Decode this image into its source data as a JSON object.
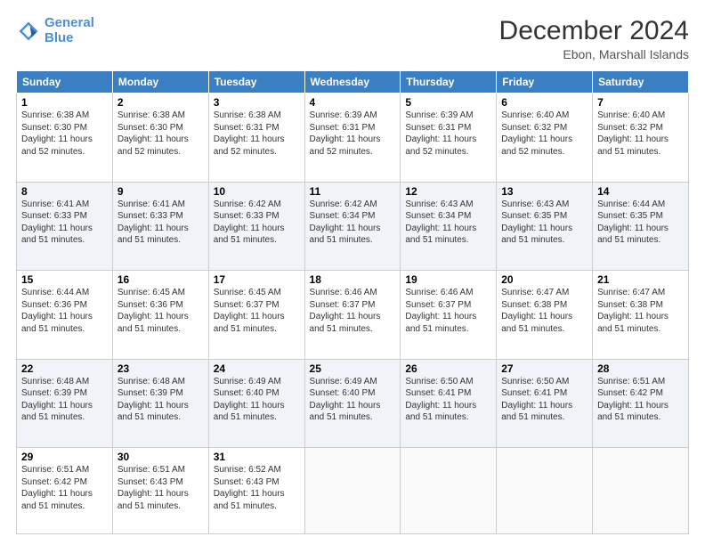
{
  "logo": {
    "line1": "General",
    "line2": "Blue"
  },
  "title": "December 2024",
  "subtitle": "Ebon, Marshall Islands",
  "days_of_week": [
    "Sunday",
    "Monday",
    "Tuesday",
    "Wednesday",
    "Thursday",
    "Friday",
    "Saturday"
  ],
  "weeks": [
    [
      {
        "day": "1",
        "sunrise": "6:38 AM",
        "sunset": "6:30 PM",
        "daylight": "11 hours and 52 minutes."
      },
      {
        "day": "2",
        "sunrise": "6:38 AM",
        "sunset": "6:30 PM",
        "daylight": "11 hours and 52 minutes."
      },
      {
        "day": "3",
        "sunrise": "6:38 AM",
        "sunset": "6:31 PM",
        "daylight": "11 hours and 52 minutes."
      },
      {
        "day": "4",
        "sunrise": "6:39 AM",
        "sunset": "6:31 PM",
        "daylight": "11 hours and 52 minutes."
      },
      {
        "day": "5",
        "sunrise": "6:39 AM",
        "sunset": "6:31 PM",
        "daylight": "11 hours and 52 minutes."
      },
      {
        "day": "6",
        "sunrise": "6:40 AM",
        "sunset": "6:32 PM",
        "daylight": "11 hours and 52 minutes."
      },
      {
        "day": "7",
        "sunrise": "6:40 AM",
        "sunset": "6:32 PM",
        "daylight": "11 hours and 51 minutes."
      }
    ],
    [
      {
        "day": "8",
        "sunrise": "6:41 AM",
        "sunset": "6:33 PM",
        "daylight": "11 hours and 51 minutes."
      },
      {
        "day": "9",
        "sunrise": "6:41 AM",
        "sunset": "6:33 PM",
        "daylight": "11 hours and 51 minutes."
      },
      {
        "day": "10",
        "sunrise": "6:42 AM",
        "sunset": "6:33 PM",
        "daylight": "11 hours and 51 minutes."
      },
      {
        "day": "11",
        "sunrise": "6:42 AM",
        "sunset": "6:34 PM",
        "daylight": "11 hours and 51 minutes."
      },
      {
        "day": "12",
        "sunrise": "6:43 AM",
        "sunset": "6:34 PM",
        "daylight": "11 hours and 51 minutes."
      },
      {
        "day": "13",
        "sunrise": "6:43 AM",
        "sunset": "6:35 PM",
        "daylight": "11 hours and 51 minutes."
      },
      {
        "day": "14",
        "sunrise": "6:44 AM",
        "sunset": "6:35 PM",
        "daylight": "11 hours and 51 minutes."
      }
    ],
    [
      {
        "day": "15",
        "sunrise": "6:44 AM",
        "sunset": "6:36 PM",
        "daylight": "11 hours and 51 minutes."
      },
      {
        "day": "16",
        "sunrise": "6:45 AM",
        "sunset": "6:36 PM",
        "daylight": "11 hours and 51 minutes."
      },
      {
        "day": "17",
        "sunrise": "6:45 AM",
        "sunset": "6:37 PM",
        "daylight": "11 hours and 51 minutes."
      },
      {
        "day": "18",
        "sunrise": "6:46 AM",
        "sunset": "6:37 PM",
        "daylight": "11 hours and 51 minutes."
      },
      {
        "day": "19",
        "sunrise": "6:46 AM",
        "sunset": "6:37 PM",
        "daylight": "11 hours and 51 minutes."
      },
      {
        "day": "20",
        "sunrise": "6:47 AM",
        "sunset": "6:38 PM",
        "daylight": "11 hours and 51 minutes."
      },
      {
        "day": "21",
        "sunrise": "6:47 AM",
        "sunset": "6:38 PM",
        "daylight": "11 hours and 51 minutes."
      }
    ],
    [
      {
        "day": "22",
        "sunrise": "6:48 AM",
        "sunset": "6:39 PM",
        "daylight": "11 hours and 51 minutes."
      },
      {
        "day": "23",
        "sunrise": "6:48 AM",
        "sunset": "6:39 PM",
        "daylight": "11 hours and 51 minutes."
      },
      {
        "day": "24",
        "sunrise": "6:49 AM",
        "sunset": "6:40 PM",
        "daylight": "11 hours and 51 minutes."
      },
      {
        "day": "25",
        "sunrise": "6:49 AM",
        "sunset": "6:40 PM",
        "daylight": "11 hours and 51 minutes."
      },
      {
        "day": "26",
        "sunrise": "6:50 AM",
        "sunset": "6:41 PM",
        "daylight": "11 hours and 51 minutes."
      },
      {
        "day": "27",
        "sunrise": "6:50 AM",
        "sunset": "6:41 PM",
        "daylight": "11 hours and 51 minutes."
      },
      {
        "day": "28",
        "sunrise": "6:51 AM",
        "sunset": "6:42 PM",
        "daylight": "11 hours and 51 minutes."
      }
    ],
    [
      {
        "day": "29",
        "sunrise": "6:51 AM",
        "sunset": "6:42 PM",
        "daylight": "11 hours and 51 minutes."
      },
      {
        "day": "30",
        "sunrise": "6:51 AM",
        "sunset": "6:43 PM",
        "daylight": "11 hours and 51 minutes."
      },
      {
        "day": "31",
        "sunrise": "6:52 AM",
        "sunset": "6:43 PM",
        "daylight": "11 hours and 51 minutes."
      },
      null,
      null,
      null,
      null
    ]
  ]
}
